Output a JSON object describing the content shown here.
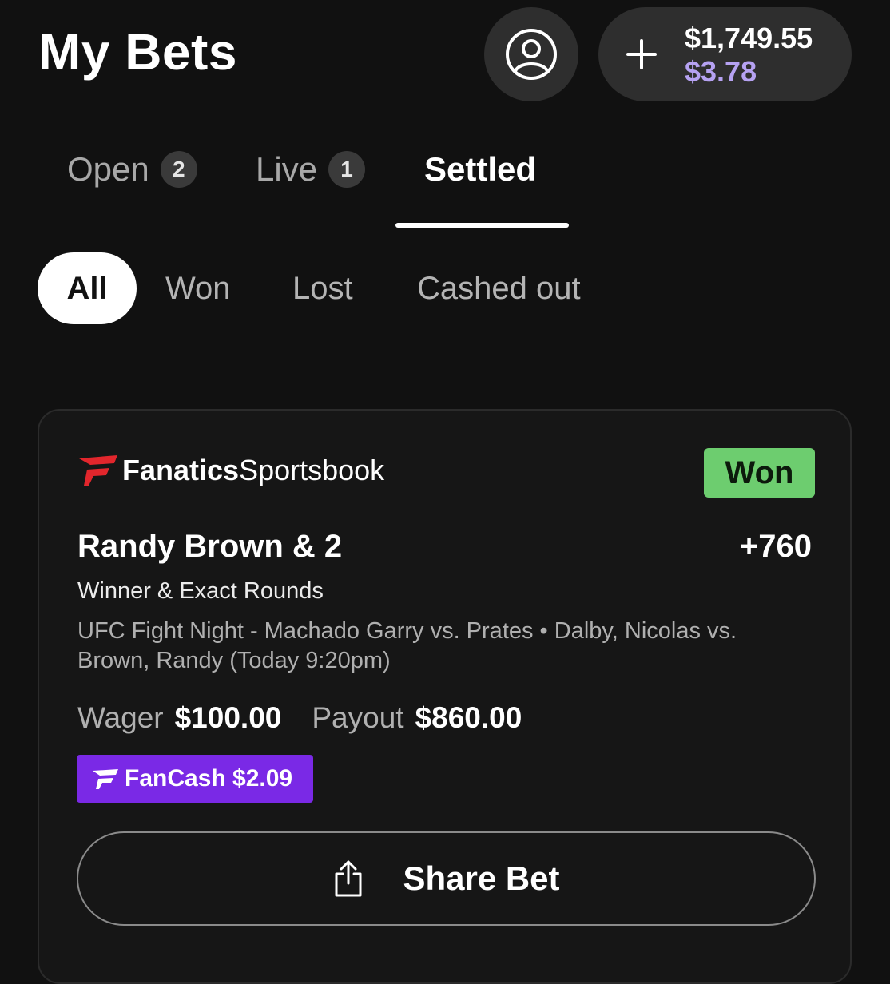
{
  "header": {
    "title": "My Bets",
    "profile_icon": "user-circle-icon",
    "add_funds_icon": "plus-icon",
    "balance": "$1,749.55",
    "bonus_balance": "$3.78",
    "bonus_color": "#b6a2f2"
  },
  "tabs": [
    {
      "label": "Open",
      "count": "2"
    },
    {
      "label": "Live",
      "count": "1"
    },
    {
      "label": "Settled",
      "active": true
    }
  ],
  "filters": [
    {
      "label": "All",
      "active": true
    },
    {
      "label": "Won"
    },
    {
      "label": "Lost"
    },
    {
      "label": "Cashed out"
    }
  ],
  "bet_card": {
    "brand_bold": "Fanatics",
    "brand_light": "Sportsbook",
    "status": "Won",
    "status_color": "#6dcd6f",
    "selection": "Randy Brown & 2",
    "odds": "+760",
    "market": "Winner & Exact Rounds",
    "event": "UFC Fight Night - Machado Garry vs. Prates • Dalby, Nicolas vs. Brown, Randy (Today 9:20pm)",
    "wager_label": "Wager",
    "wager": "$100.00",
    "payout_label": "Payout",
    "payout": "$860.00",
    "fancash": "FanCash $2.09",
    "fancash_color": "#7a29e6",
    "share_label": "Share Bet",
    "share_icon": "share-icon"
  }
}
